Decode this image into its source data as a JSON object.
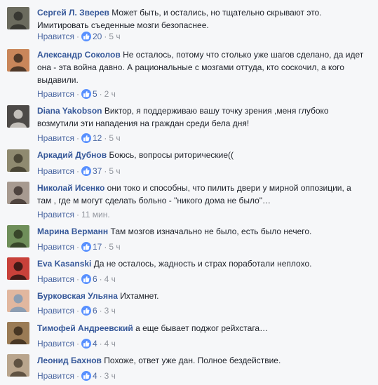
{
  "like_label": "Нравится",
  "separator": "·",
  "colors": {
    "author": "#365899",
    "link": "#4b67a1",
    "muted": "#90949c",
    "like_badge": "#5890ff"
  },
  "comments": [
    {
      "author": "Сергей Л. Зверев",
      "text": "Может быть, и остались, но тщательно скрывают это. Имитировать съеденные мозги безопаснее.",
      "likes": "20",
      "time": "5 ч",
      "avatar_colors": [
        "#6b6b5e",
        "#2f2f2a"
      ]
    },
    {
      "author": "Александр Соколов",
      "text": "Не осталось, потому что столько уже шагов сделано, да идет она - эта война давно. А рациональные с мозгами оттуда, кто соскочил, а кого выдавили.",
      "likes": "5",
      "time": "2 ч",
      "avatar_colors": [
        "#c9865a",
        "#3a2a20"
      ]
    },
    {
      "author": "Diana Yakobson",
      "text": "Виктор, я поддерживаю вашу точку зрения ,меня глубоко возмутили эти нападения на граждан среди бела дня!",
      "likes": "12",
      "time": "5 ч",
      "avatar_colors": [
        "#4d4a48",
        "#d8d3cf"
      ]
    },
    {
      "author": "Аркадий Дубнов",
      "text": "Боюсь, вопросы риторические((",
      "likes": "37",
      "time": "5 ч",
      "avatar_colors": [
        "#8f8a70",
        "#3e3a2c"
      ]
    },
    {
      "author": "Николай Исенко",
      "text": "они токо и способны, что пилить двери у мирной оппозиции, а там , где м могут сделать больно - \"никого дома не было\"…",
      "likes": "",
      "time": "11 мин.",
      "avatar_colors": [
        "#a79a90",
        "#403531"
      ]
    },
    {
      "author": "Марина Верманн",
      "text": "Там мозгов изначально не было, есть было нечего.",
      "likes": "17",
      "time": "5 ч",
      "avatar_colors": [
        "#6f8f5a",
        "#2f3b22"
      ]
    },
    {
      "author": "Eva Kasanski",
      "text": "Да не осталось, жадность и страх поработали неплохо.",
      "likes": "6",
      "time": "4 ч",
      "avatar_colors": [
        "#c8413a",
        "#2a1412"
      ]
    },
    {
      "author": "Бурковская Ульяна",
      "text": "Ихтамнет.",
      "likes": "6",
      "time": "3 ч",
      "avatar_colors": [
        "#e1b79f",
        "#7e9ab5"
      ]
    },
    {
      "author": "Тимофей Андреевский",
      "text": "а еще бывает поджог рейхстага…",
      "likes": "4",
      "time": "4 ч",
      "avatar_colors": [
        "#9a7b55",
        "#3a2c1c"
      ]
    },
    {
      "author": "Леонид Бахнов",
      "text": "Похоже, ответ уже дан. Полное бездействие.",
      "likes": "4",
      "time": "3 ч",
      "avatar_colors": [
        "#b9a58d",
        "#4f4335"
      ]
    }
  ]
}
